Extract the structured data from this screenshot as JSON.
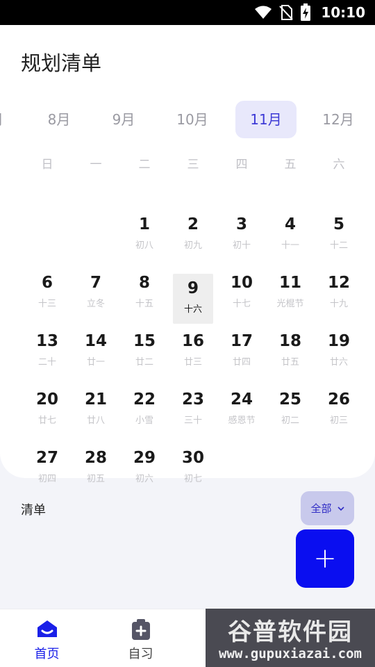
{
  "status_bar": {
    "time": "10:10"
  },
  "header": {
    "title": "规划清单"
  },
  "months": [
    {
      "label": "月",
      "active": false
    },
    {
      "label": "8月",
      "active": false
    },
    {
      "label": "9月",
      "active": false
    },
    {
      "label": "10月",
      "active": false
    },
    {
      "label": "11月",
      "active": true
    },
    {
      "label": "12月",
      "active": false
    }
  ],
  "weekdays": [
    "日",
    "一",
    "二",
    "三",
    "四",
    "五",
    "六"
  ],
  "days": [
    {
      "num": "1",
      "lunar": "初八"
    },
    {
      "num": "2",
      "lunar": "初九"
    },
    {
      "num": "3",
      "lunar": "初十"
    },
    {
      "num": "4",
      "lunar": "十一"
    },
    {
      "num": "5",
      "lunar": "十二"
    },
    {
      "num": "6",
      "lunar": "十三"
    },
    {
      "num": "7",
      "lunar": "立冬"
    },
    {
      "num": "8",
      "lunar": "十五"
    },
    {
      "num": "9",
      "lunar": "十六",
      "today": true
    },
    {
      "num": "10",
      "lunar": "十七"
    },
    {
      "num": "11",
      "lunar": "光棍节"
    },
    {
      "num": "12",
      "lunar": "十九"
    },
    {
      "num": "13",
      "lunar": "二十"
    },
    {
      "num": "14",
      "lunar": "廿一"
    },
    {
      "num": "15",
      "lunar": "廿二"
    },
    {
      "num": "16",
      "lunar": "廿三"
    },
    {
      "num": "17",
      "lunar": "廿四"
    },
    {
      "num": "18",
      "lunar": "廿五"
    },
    {
      "num": "19",
      "lunar": "廿六"
    },
    {
      "num": "20",
      "lunar": "廿七"
    },
    {
      "num": "21",
      "lunar": "廿八"
    },
    {
      "num": "22",
      "lunar": "小雪"
    },
    {
      "num": "23",
      "lunar": "三十"
    },
    {
      "num": "24",
      "lunar": "感恩节"
    },
    {
      "num": "25",
      "lunar": "初二"
    },
    {
      "num": "26",
      "lunar": "初三"
    },
    {
      "num": "27",
      "lunar": "初四"
    },
    {
      "num": "28",
      "lunar": "初五"
    },
    {
      "num": "29",
      "lunar": "初六"
    },
    {
      "num": "30",
      "lunar": "初七"
    }
  ],
  "list": {
    "label": "清单",
    "filter_label": "全部",
    "add_symbol": "+"
  },
  "nav": [
    {
      "label": "首页",
      "icon": "home-icon",
      "active": true
    },
    {
      "label": "自习",
      "icon": "clipboard-add-icon",
      "active": false
    }
  ],
  "watermark": {
    "title": "谷普软件园",
    "url": "www.gupuxiazai.com"
  },
  "colors": {
    "accent": "#0a0ef0",
    "month_active_bg": "#e8e8fb",
    "filter_bg": "#c8c9ec"
  }
}
